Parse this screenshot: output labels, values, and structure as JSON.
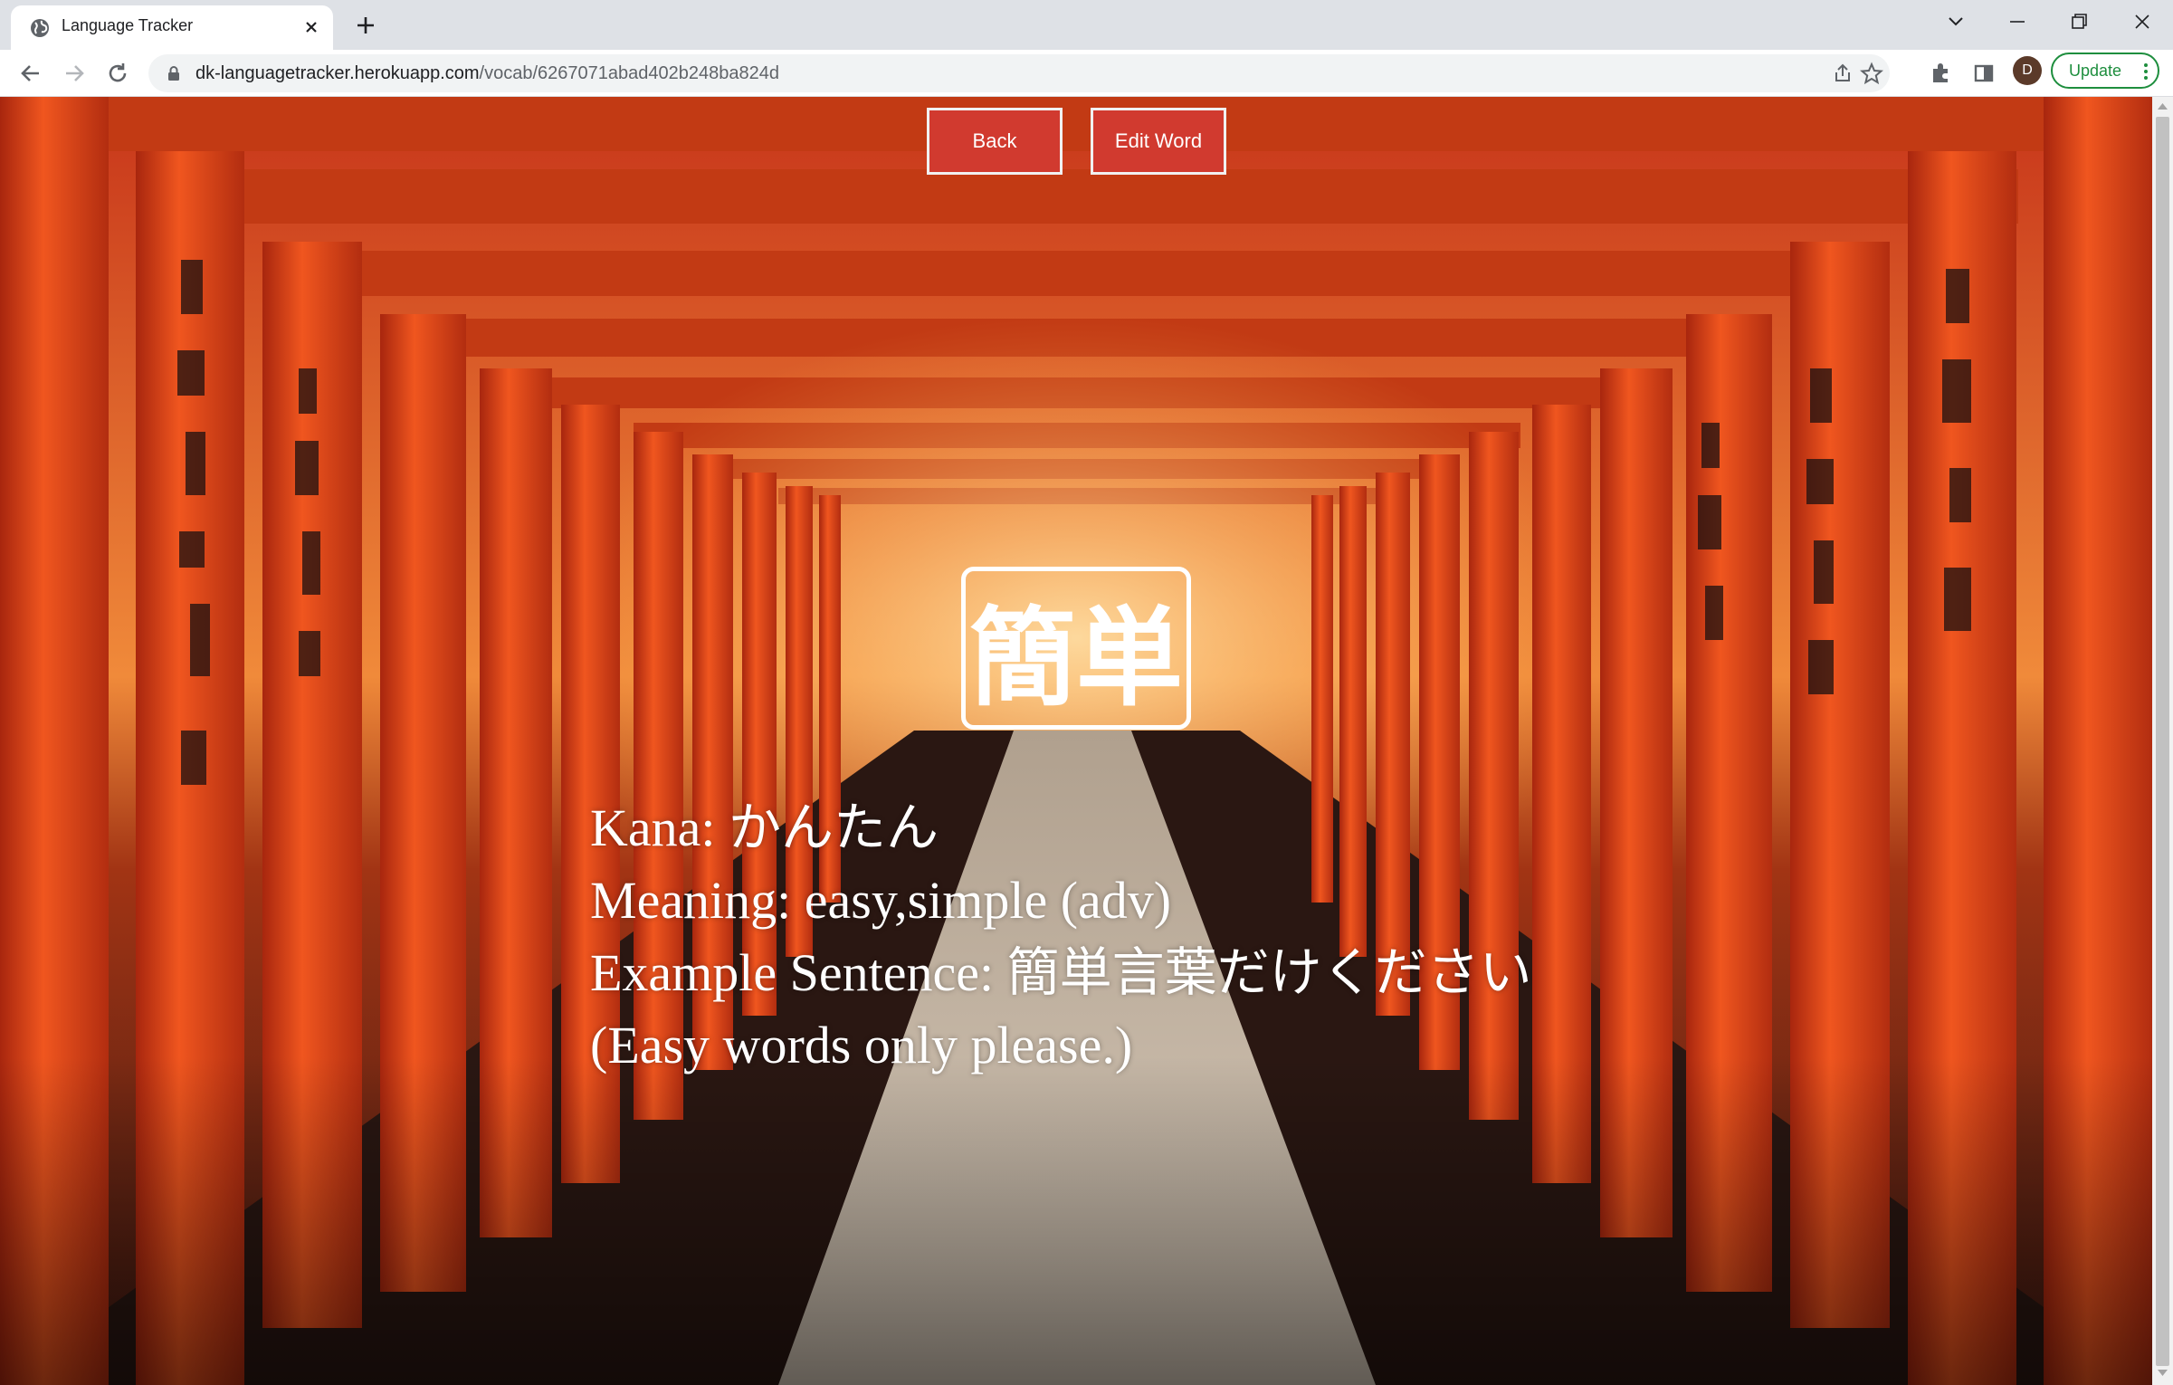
{
  "browser": {
    "tab_title": "Language Tracker",
    "url_host": "dk-languagetracker.herokuapp.com",
    "url_path": "/vocab/6267071abad402b248ba824d",
    "profile_initial": "D",
    "update_label": "Update"
  },
  "page": {
    "buttons": {
      "back": "Back",
      "edit_word": "Edit Word"
    },
    "word": {
      "kanji": "簡単",
      "kana_line": "Kana: かんたん",
      "meaning_line": "Meaning: easy,simple (adv)",
      "example_line": "Example Sentence: 簡単言葉だけください",
      "translation_line": "(Easy words only please.)"
    }
  },
  "colors": {
    "button_red": "#d13a2f",
    "torii_orange": "#e4501f",
    "text_white": "#ffffff"
  }
}
